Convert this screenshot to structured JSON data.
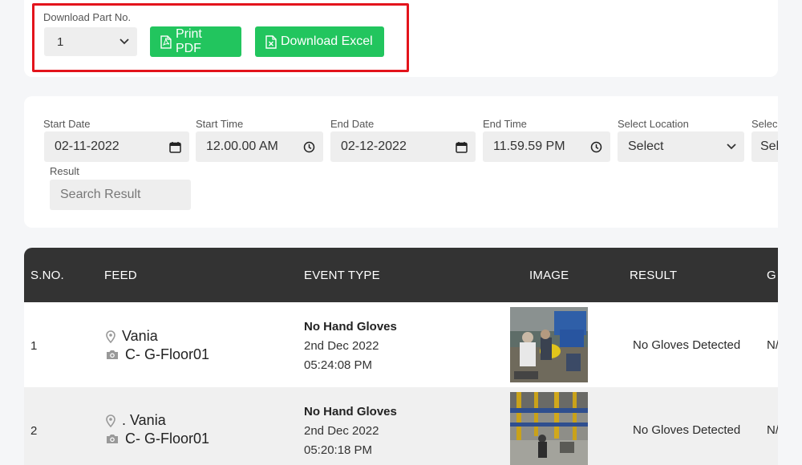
{
  "download": {
    "label": "Download Part No.",
    "part_value": "1",
    "print_pdf": "Print PDF",
    "download_excel": "Download Excel"
  },
  "filters": {
    "start_date": {
      "label": "Start Date",
      "value": "02-11-2022"
    },
    "start_time": {
      "label": "Start Time",
      "value": "12.00.00 AM"
    },
    "end_date": {
      "label": "End Date",
      "value": "02-12-2022"
    },
    "end_time": {
      "label": "End Time",
      "value": "11.59.59 PM"
    },
    "location": {
      "label": "Select Location",
      "value": "Select"
    },
    "extra": {
      "label": "Selec",
      "value": "Sel"
    },
    "result": {
      "label": "Result",
      "placeholder": "Search Result"
    }
  },
  "table": {
    "headers": [
      "S.NO.",
      "FEED",
      "EVENT TYPE",
      "IMAGE",
      "RESULT",
      "G"
    ],
    "rows": [
      {
        "sno": "1",
        "location": "Vania",
        "camera": "C- G-Floor01",
        "event": "No Hand Gloves",
        "date": "2nd Dec 2022",
        "time": "05:24:08 PM",
        "result": "No Gloves Detected",
        "extra": "N/"
      },
      {
        "sno": "2",
        "location": ". Vania",
        "camera": "C- G-Floor01",
        "event": "No Hand Gloves",
        "date": "2nd Dec 2022",
        "time": "05:20:18 PM",
        "result": "No Gloves Detected",
        "extra": "N/"
      }
    ]
  },
  "colors": {
    "accent_green": "#22c55e",
    "highlight_red": "#e3141c",
    "table_header": "#333333"
  },
  "icons": [
    "chevron-down-icon",
    "pdf-file-icon",
    "excel-file-icon",
    "calendar-icon",
    "clock-icon",
    "location-pin-icon",
    "camera-icon"
  ]
}
